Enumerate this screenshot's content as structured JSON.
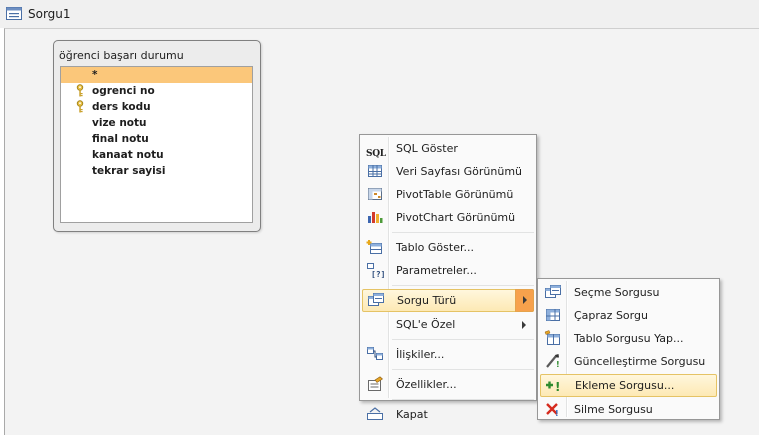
{
  "window": {
    "title": "Sorgu1"
  },
  "table": {
    "name": "öğrenci başarı durumu",
    "fields": [
      {
        "label": "*",
        "selected": true,
        "key": false
      },
      {
        "label": "ogrenci no",
        "selected": false,
        "key": true
      },
      {
        "label": "ders kodu",
        "selected": false,
        "key": true
      },
      {
        "label": "vize notu",
        "selected": false,
        "key": false
      },
      {
        "label": "final notu",
        "selected": false,
        "key": false
      },
      {
        "label": "kanaat notu",
        "selected": false,
        "key": false
      },
      {
        "label": "tekrar sayisi",
        "selected": false,
        "key": false
      }
    ]
  },
  "context_menu": {
    "items": [
      {
        "label": "SQL Göster",
        "icon": "sql-icon"
      },
      {
        "label": "Veri Sayfası Görünümü",
        "icon": "datasheet-icon"
      },
      {
        "label": "PivotTable Görünümü",
        "icon": "pivottable-icon"
      },
      {
        "label": "PivotChart Görünümü",
        "icon": "pivotchart-icon"
      },
      {
        "label": "Tablo Göster...",
        "icon": "show-table-icon"
      },
      {
        "label": "Parametreler...",
        "icon": "parameters-icon"
      },
      {
        "label": "Sorgu Türü",
        "icon": "query-type-icon"
      },
      {
        "label": "SQL'e Özel",
        "icon": ""
      },
      {
        "label": "İlişkiler...",
        "icon": "relationships-icon"
      },
      {
        "label": "Özellikler...",
        "icon": "properties-icon"
      },
      {
        "label": "Kapat",
        "icon": "close-icon"
      }
    ]
  },
  "submenu": {
    "items": [
      {
        "label": "Seçme Sorgusu",
        "icon": "select-query-icon"
      },
      {
        "label": "Çapraz Sorgu",
        "icon": "crosstab-query-icon"
      },
      {
        "label": "Tablo Sorgusu Yap...",
        "icon": "make-table-query-icon"
      },
      {
        "label": "Güncelleştirme Sorgusu",
        "icon": "update-query-icon"
      },
      {
        "label": "Ekleme Sorgusu...",
        "icon": "append-query-icon"
      },
      {
        "label": "Silme Sorgusu",
        "icon": "delete-query-icon"
      }
    ]
  },
  "colors": {
    "field_selection": "#fbc77a",
    "menu_highlight": "#fde9b4",
    "submenu_arrow_highlight": "#f7a14c"
  }
}
